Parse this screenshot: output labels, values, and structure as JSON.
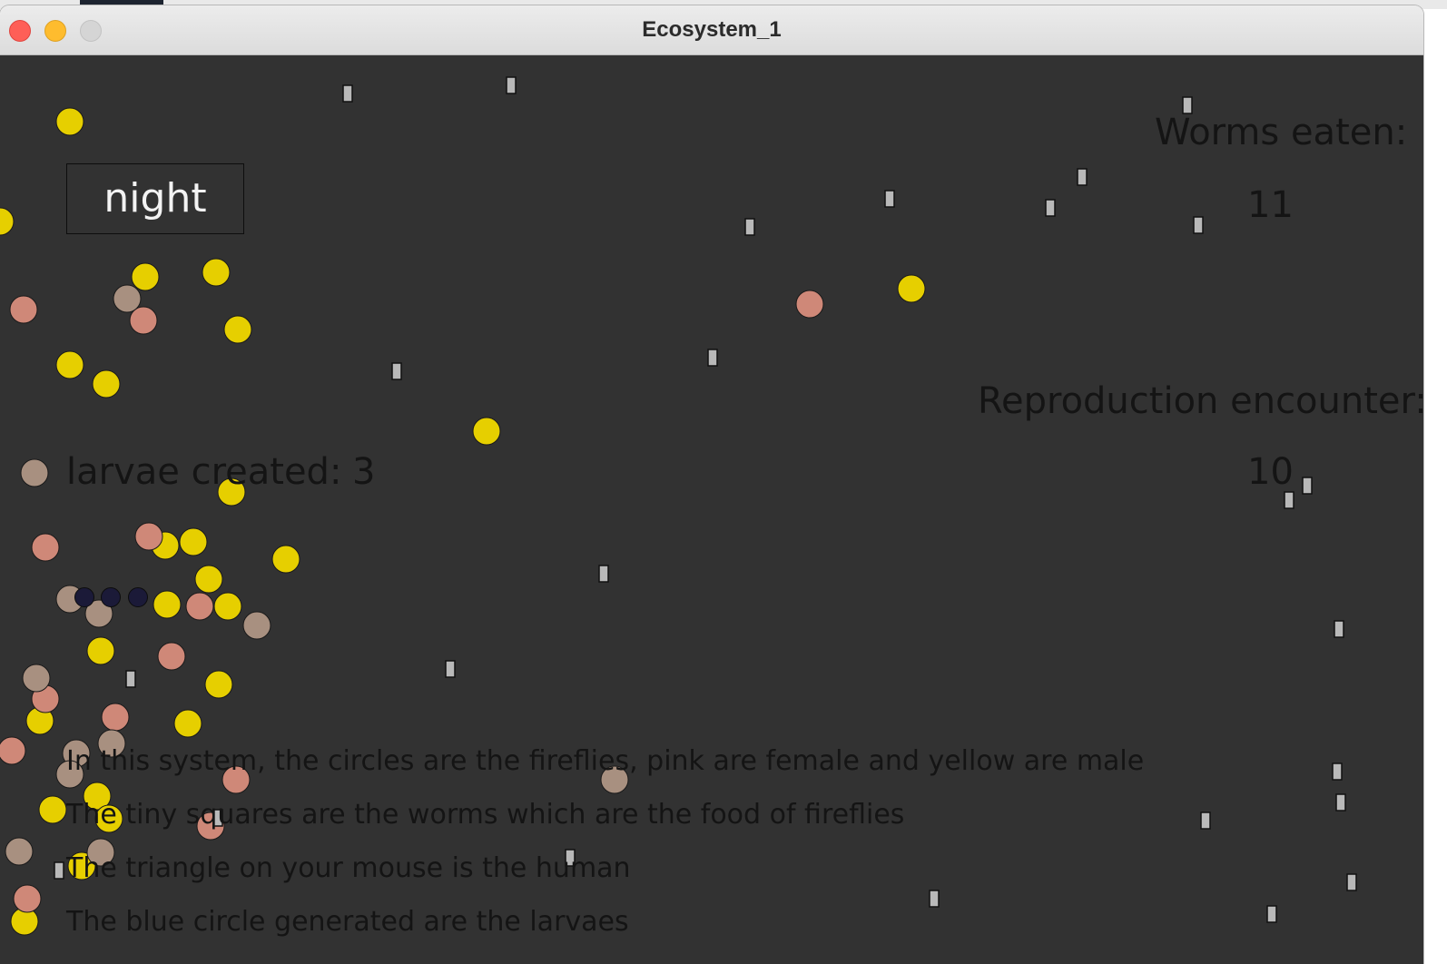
{
  "window": {
    "title": "Ecosystem_1"
  },
  "controls": {
    "close": "close-button",
    "minimize": "minimize-button",
    "zoom": "zoom-button"
  },
  "hud": {
    "mode": "night",
    "worms_eaten_label": "Worms eaten:",
    "worms_eaten_value": "11",
    "reproduction_label": "Reproduction encounter:",
    "reproduction_value": "10",
    "larvae_label": "larvae created:",
    "larvae_value": "3"
  },
  "info_lines": [
    "In this system, the circles are the fireflies, pink are female and yellow are male",
    "The tiny squares are the worms which are the food of fireflies",
    "The triangle on your mouse is the human",
    "The blue circle generated are the larvaes"
  ],
  "colors": {
    "background": "#323232",
    "male_firefly": "#e6cf00",
    "female_firefly": "#cf8878",
    "dim_firefly": "#a89080",
    "larva": "#1b1a38",
    "worm": "#b9b9b9"
  }
}
